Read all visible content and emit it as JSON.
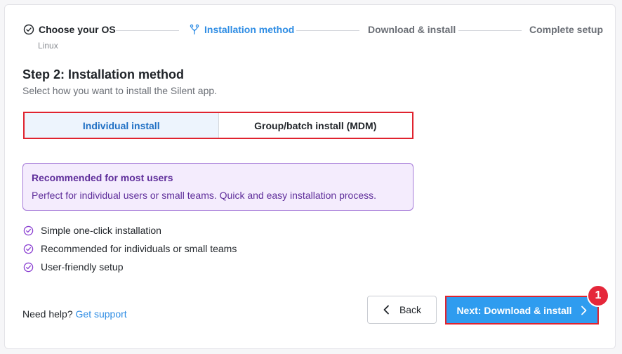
{
  "stepper": {
    "steps": [
      {
        "label": "Choose your OS",
        "sub": "Linux",
        "state": "completed"
      },
      {
        "label": "Installation method",
        "state": "active"
      },
      {
        "label": "Download & install",
        "state": "pending"
      },
      {
        "label": "Complete setup",
        "state": "pending"
      }
    ]
  },
  "main": {
    "title": "Step 2: Installation method",
    "subtitle": "Select how you want to install the Silent app."
  },
  "method_toggle": {
    "options": [
      {
        "label": "Individual install",
        "selected": true
      },
      {
        "label": "Group/batch install (MDM)",
        "selected": false
      }
    ]
  },
  "info_box": {
    "title": "Recommended for most users",
    "body": "Perfect for individual users or small teams. Quick and easy installation process."
  },
  "features": [
    "Simple one-click installation",
    "Recommended for individuals or small teams",
    "User-friendly setup"
  ],
  "footer": {
    "help_text": "Need help?",
    "help_link": "Get support",
    "back_label": "Back",
    "next_label": "Next: Download & install",
    "badge": "1"
  },
  "colors": {
    "accent": "#2f9cef",
    "active_step": "#2f8de4",
    "info_bg": "#f4ecfd",
    "info_border": "#a57ad8",
    "info_text": "#5e2d9a",
    "highlight": "#e0232f"
  },
  "icons": {
    "step_completed": "check-circle-icon",
    "step_active": "fork-icon",
    "feature": "check-circle-icon",
    "back": "chevron-left-icon",
    "next": "chevron-right-icon"
  }
}
